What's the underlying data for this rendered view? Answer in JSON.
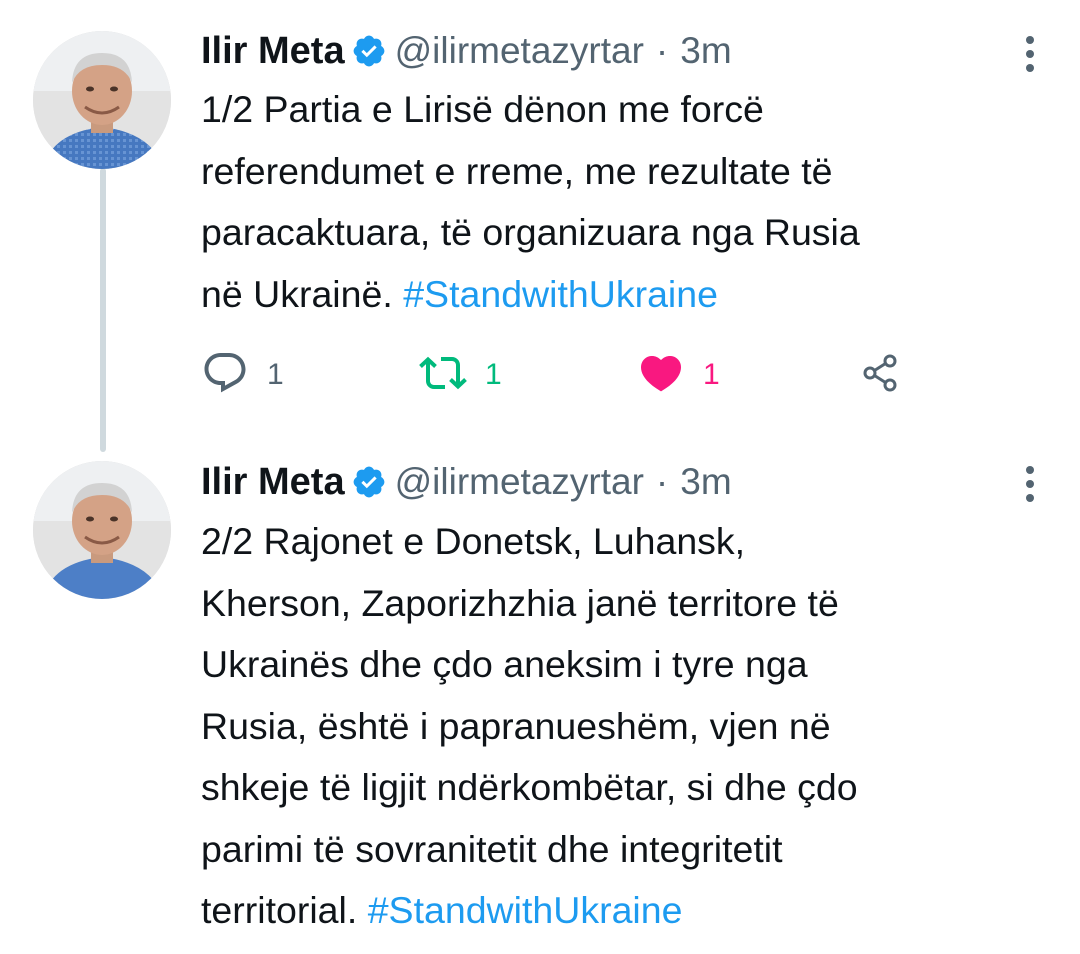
{
  "thread": [
    {
      "author": {
        "name": "Ilir Meta",
        "handle": "@ilirmetazyrtar",
        "separator": "·",
        "time": "3m"
      },
      "text_lines": [
        "1/2 Partia e Lirisë dënon me forcë",
        "referendumet e rreme, me rezultate të",
        "paracaktuara, të organizuara nga Rusia",
        "në Ukrainë."
      ],
      "hashtag": "#StandwithUkraine",
      "actions": {
        "replies": "1",
        "retweets": "1",
        "likes": "1"
      }
    },
    {
      "author": {
        "name": "Ilir Meta",
        "handle": "@ilirmetazyrtar",
        "separator": "·",
        "time": "3m"
      },
      "text_lines": [
        "2/2 Rajonet e Donetsk, Luhansk,",
        "Kherson, Zaporizhzhia janë territore të",
        "Ukrainës dhe çdo aneksim i tyre nga",
        "Rusia, është i papranueshëm, vjen në",
        "shkeje të ligjit ndërkombëtar, si dhe çdo",
        "parimi të sovranitetit dhe integritetit",
        "territorial."
      ],
      "hashtag": "#StandwithUkraine"
    }
  ],
  "colors": {
    "text": "#0f1419",
    "secondary": "#536471",
    "link": "#1d9bf0",
    "verified": "#1d9bf0",
    "retweet_active": "#00ba7c",
    "like_active": "#f91880",
    "thread_line": "#cfd9de"
  },
  "icons": {
    "verified": "verified-badge-icon",
    "more": "more-vertical-icon",
    "reply": "reply-bubble-icon",
    "retweet": "retweet-icon",
    "like": "heart-icon",
    "share": "share-icon"
  }
}
